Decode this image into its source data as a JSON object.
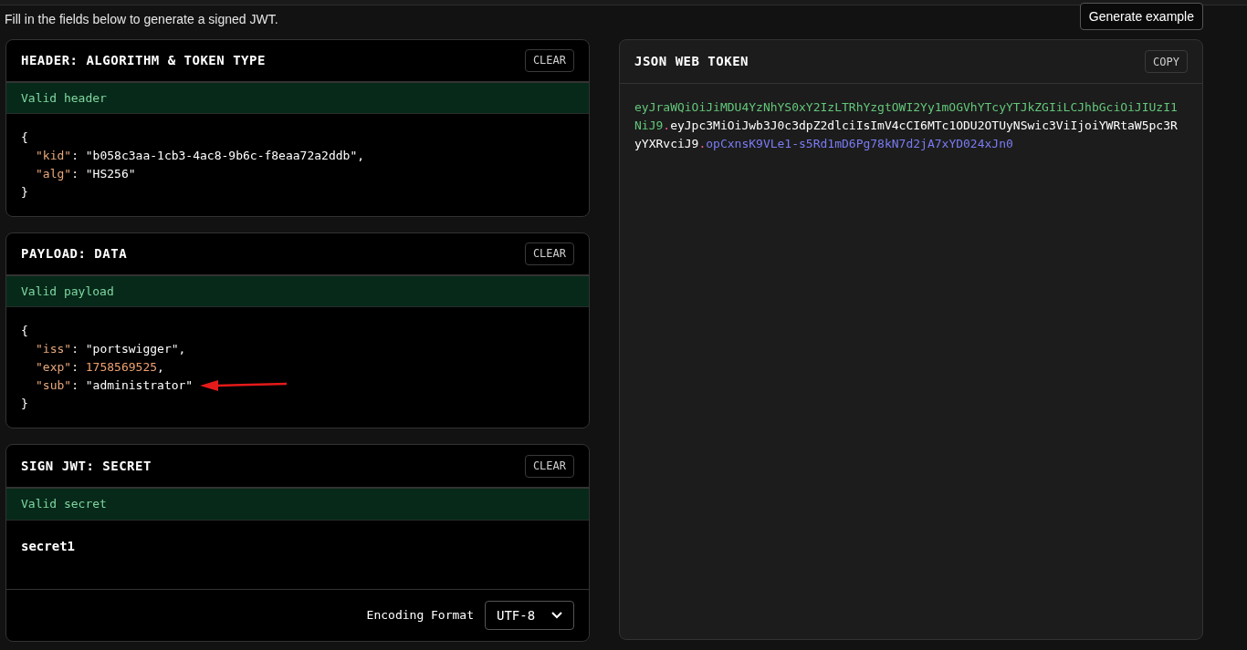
{
  "intro": "Fill in the fields below to generate a signed JWT.",
  "generate_button": "Generate example",
  "header_panel": {
    "title": "HEADER: ALGORITHM & TOKEN TYPE",
    "clear_button": "CLEAR",
    "status": "Valid header",
    "valid": true,
    "open": "{",
    "close": "}",
    "lines": [
      {
        "key": "\"kid\"",
        "sep": ":",
        "value": "\"b058c3aa-1cb3-4ac8-9b6c-f8eaa72a2ddb\"",
        "comma": ",",
        "kind": "string"
      },
      {
        "key": "\"alg\"",
        "sep": ":",
        "value": "\"HS256\"",
        "kind": "string"
      }
    ]
  },
  "payload_panel": {
    "title": "PAYLOAD: DATA",
    "clear_button": "CLEAR",
    "status": "Valid payload",
    "valid": true,
    "open": "{",
    "close": "}",
    "lines": [
      {
        "key": "\"iss\"",
        "sep": ":",
        "value": "\"portswigger\"",
        "comma": ",",
        "kind": "string"
      },
      {
        "key": "\"exp\"",
        "sep": ":",
        "value": "1758569525",
        "comma": ",",
        "kind": "number"
      },
      {
        "key": "\"sub\"",
        "sep": ":",
        "value": "\"administrator\"",
        "kind": "string",
        "annotated": true
      }
    ]
  },
  "secret_panel": {
    "title": "SIGN JWT: SECRET",
    "clear_button": "CLEAR",
    "status": "Valid secret",
    "valid": true,
    "value": "secret1",
    "encoding_label": "Encoding Format",
    "encoding_value": "UTF-8"
  },
  "token_panel": {
    "title": "JSON WEB TOKEN",
    "copy_button": "COPY",
    "segments": [
      {
        "kind": "header",
        "text": "eyJraWQiOiJiMDU4YzNhYS0xY2IzLTRhYzgtOWI2Yy1mOGVhYTcyYTJkZGIiLCJhbGciOiJIUzI1NiJ9"
      },
      {
        "kind": "dot",
        "text": "."
      },
      {
        "kind": "payload",
        "text": "eyJpc3MiOiJwb3J0c3dpZ2dlciIsImV4cCI6MTc1ODU2OTUyNSwic3ViIjoiYWRtaW5pc3RyYXRvciJ9"
      },
      {
        "kind": "dot",
        "text": "."
      },
      {
        "kind": "signature",
        "text": "opCxnsK9VLe1-s5Rd1mD6Pg78kN7d2jA7xYD024xJn0"
      }
    ]
  }
}
